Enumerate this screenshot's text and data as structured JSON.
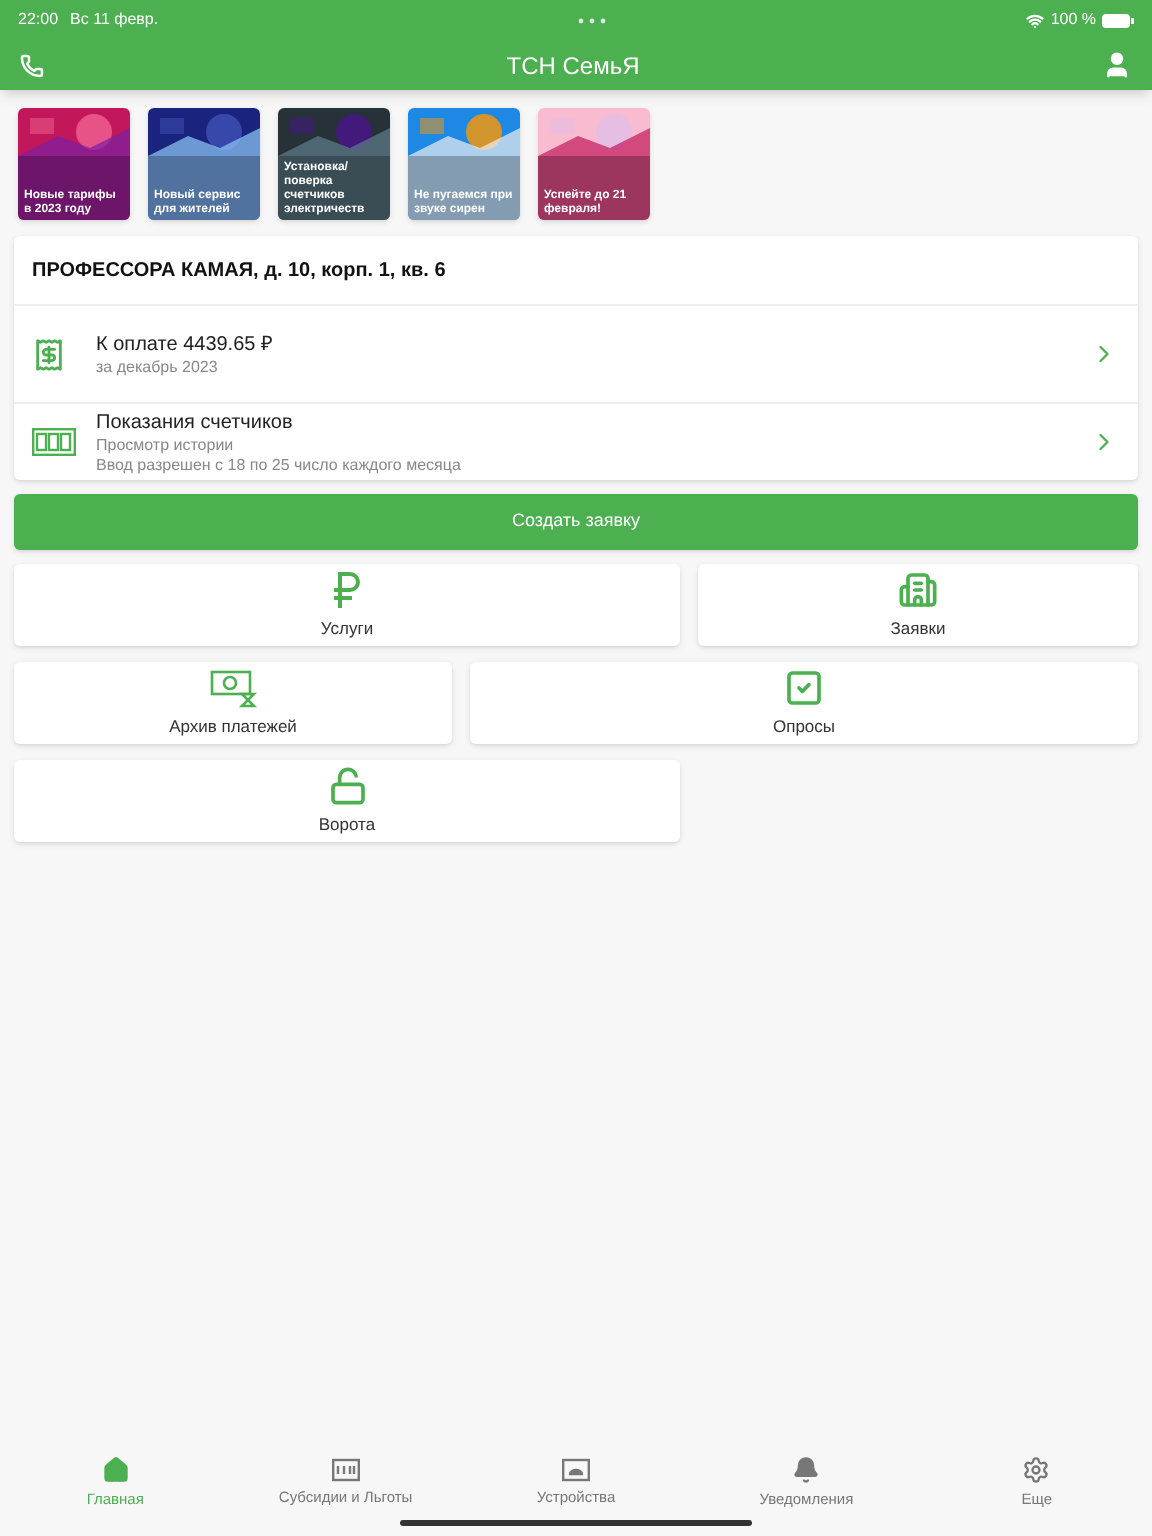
{
  "status_bar": {
    "time": "22:00",
    "date": "Вс 11 февр.",
    "battery": "100 %"
  },
  "app_bar": {
    "title": "ТСН СемьЯ"
  },
  "stories": [
    {
      "caption": "Новые тарифы в 2023 году",
      "kind": "picture"
    },
    {
      "caption": "Новый сервис для жителей",
      "kind": "picture"
    },
    {
      "caption": "Установка/ поверка счетчиков электричеств",
      "kind": "picture"
    },
    {
      "caption": "Не пугаемся при звуке сирен",
      "kind": "picture"
    },
    {
      "caption": "Успейте до 21 февраля!",
      "kind": "picture"
    }
  ],
  "account": {
    "address": "ПРОФЕССОРА КАМАЯ, д. 10, корп. 1, кв. 6",
    "rows": [
      {
        "kind": "payment",
        "title": "К оплате 4439.65 ₽",
        "lines": [
          "за декабрь 2023"
        ]
      },
      {
        "kind": "meters",
        "title": "Показания счетчиков",
        "lines": [
          "Просмотр истории",
          "Ввод разрешен с 18 по 25 число каждого месяца"
        ]
      }
    ]
  },
  "create_button": "Создать заявку",
  "tiles": [
    [
      {
        "kind": "ruble",
        "label": "Услуги"
      },
      {
        "kind": "building",
        "label": "Заявки"
      }
    ],
    [
      {
        "kind": "archive",
        "label": "Архив платежей"
      },
      {
        "kind": "poll",
        "label": "Опросы"
      }
    ],
    [
      {
        "kind": "lock",
        "label": "Ворота"
      }
    ]
  ],
  "bottom_nav": [
    {
      "kind": "home",
      "label": "Главная",
      "selected": true
    },
    {
      "kind": "benefits",
      "label": "Субсидии и Льготы",
      "selected": false
    },
    {
      "kind": "devices",
      "label": "Устройства",
      "selected": false
    },
    {
      "kind": "bell",
      "label": "Уведомления",
      "selected": false
    },
    {
      "kind": "gear",
      "label": "Еще",
      "selected": false
    }
  ]
}
